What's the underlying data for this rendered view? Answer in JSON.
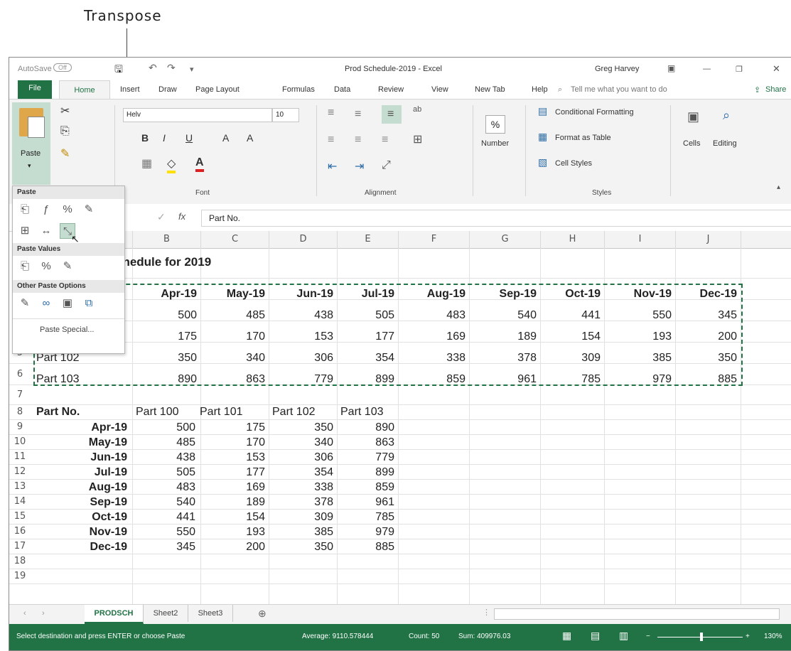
{
  "callout": "Transpose",
  "titlebar": {
    "autosave": "AutoSave",
    "autosave_state": "Off",
    "title": "Prod Schedule-2019 - Excel",
    "user": "Greg Harvey"
  },
  "tabs": [
    "File",
    "Home",
    "Insert",
    "Draw",
    "Page Layout",
    "Formulas",
    "Data",
    "Review",
    "View",
    "New Tab",
    "Help"
  ],
  "tell_me": "Tell me what you want to do",
  "share": "Share",
  "ribbon": {
    "paste_label": "Paste",
    "font_name": "Helv",
    "font_size": "10",
    "font_group": "Font",
    "alignment_group": "Alignment",
    "number_label": "Number",
    "number_symbol": "%",
    "cond_format": "Conditional Formatting",
    "format_table": "Format as Table",
    "cell_styles": "Cell Styles",
    "styles_group": "Styles",
    "cells_label": "Cells",
    "editing_label": "Editing"
  },
  "paste_menu": {
    "paste_header": "Paste",
    "paste_values_header": "Paste Values",
    "other_header": "Other Paste Options",
    "paste_special": "Paste Special..."
  },
  "formula_bar": {
    "fx": "fx",
    "content": "Part No."
  },
  "columns": [
    "B",
    "C",
    "D",
    "E",
    "F",
    "G",
    "H",
    "I",
    "J"
  ],
  "rows": [
    "5",
    "6",
    "7",
    "8",
    "9",
    "10",
    "11",
    "12",
    "13",
    "14",
    "15",
    "16",
    "17",
    "18",
    "19"
  ],
  "sheet": {
    "title_fragment": "chedule for 2019",
    "months": [
      "Apr-19",
      "May-19",
      "Jun-19",
      "Jul-19",
      "Aug-19",
      "Sep-19",
      "Oct-19",
      "Nov-19",
      "Dec-19"
    ],
    "row3": [
      "500",
      "485",
      "438",
      "505",
      "483",
      "540",
      "441",
      "550",
      "345"
    ],
    "row4": [
      "175",
      "170",
      "153",
      "177",
      "169",
      "189",
      "154",
      "193",
      "200"
    ],
    "row5_label": "Part 102",
    "row5": [
      "350",
      "340",
      "306",
      "354",
      "338",
      "378",
      "309",
      "385",
      "350"
    ],
    "row6_label": "Part 103",
    "row6": [
      "890",
      "863",
      "779",
      "899",
      "859",
      "961",
      "785",
      "979",
      "885"
    ],
    "t_header": [
      "Part No.",
      "Part 100",
      "Part 101",
      "Part 102",
      "Part 103"
    ],
    "t_rows": [
      [
        "Apr-19",
        "500",
        "175",
        "350",
        "890"
      ],
      [
        "May-19",
        "485",
        "170",
        "340",
        "863"
      ],
      [
        "Jun-19",
        "438",
        "153",
        "306",
        "779"
      ],
      [
        "Jul-19",
        "505",
        "177",
        "354",
        "899"
      ],
      [
        "Aug-19",
        "483",
        "169",
        "338",
        "859"
      ],
      [
        "Sep-19",
        "540",
        "189",
        "378",
        "961"
      ],
      [
        "Oct-19",
        "441",
        "154",
        "309",
        "785"
      ],
      [
        "Nov-19",
        "550",
        "193",
        "385",
        "979"
      ],
      [
        "Dec-19",
        "345",
        "200",
        "350",
        "885"
      ]
    ]
  },
  "sheet_tabs": [
    "PRODSCH",
    "Sheet2",
    "Sheet3"
  ],
  "status": {
    "message": "Select destination and press ENTER or choose Paste",
    "average": "Average: 9110.578444",
    "count": "Count: 50",
    "sum": "Sum: 409976.03",
    "zoom": "130%"
  },
  "colors": {
    "accent": "#217346"
  }
}
